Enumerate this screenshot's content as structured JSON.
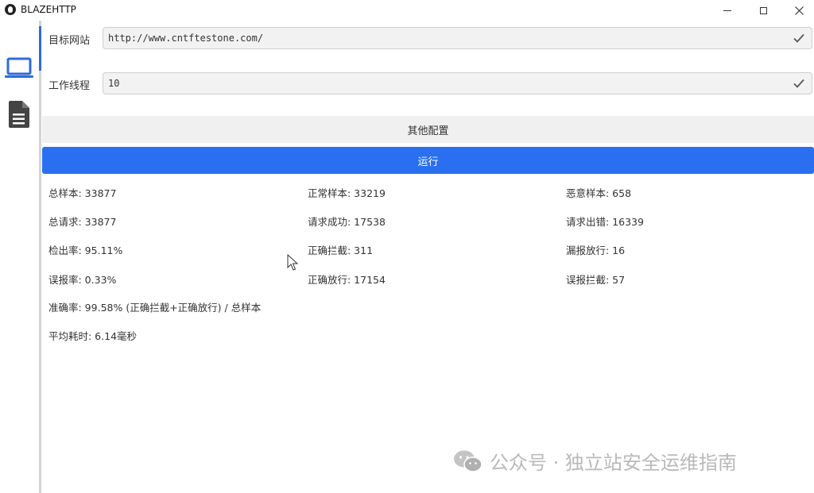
{
  "window": {
    "title": "BLAZEHTTP"
  },
  "form": {
    "target_label": "目标网站",
    "target_value": "http://www.cntftestone.com/",
    "threads_label": "工作线程",
    "threads_value": "10"
  },
  "buttons": {
    "other_config": "其他配置",
    "run": "运行"
  },
  "stats": {
    "total_samples": "总样本: 33877",
    "normal_samples": "正常样本: 33219",
    "malicious_samples": "恶意样本: 658",
    "total_requests": "总请求: 33877",
    "request_success": "请求成功: 17538",
    "request_error": "请求出错: 16339",
    "detection_rate": "检出率: 95.11%",
    "correct_block": "正确拦截: 311",
    "missed_pass": "漏报放行: 16",
    "false_positive_rate": "误报率: 0.33%",
    "correct_pass": "正确放行: 17154",
    "false_block": "误报拦截: 57",
    "accuracy": "准确率: 99.58% (正确拦截+正确放行) / 总样本",
    "avg_time": "平均耗时: 6.14毫秒"
  },
  "watermark": {
    "text": "公众号 · 独立站安全运维指南"
  },
  "icons": [
    "app-logo-icon",
    "minimize-icon",
    "maximize-icon",
    "close-icon",
    "laptop-icon",
    "document-icon",
    "check-icon",
    "mouse-cursor-icon",
    "wechat-icon"
  ],
  "colors": {
    "accent": "#2a6ff0",
    "indicator": "#2f6bd8",
    "laptop_icon": "#2f6bd8",
    "doc_icon": "#444444"
  }
}
